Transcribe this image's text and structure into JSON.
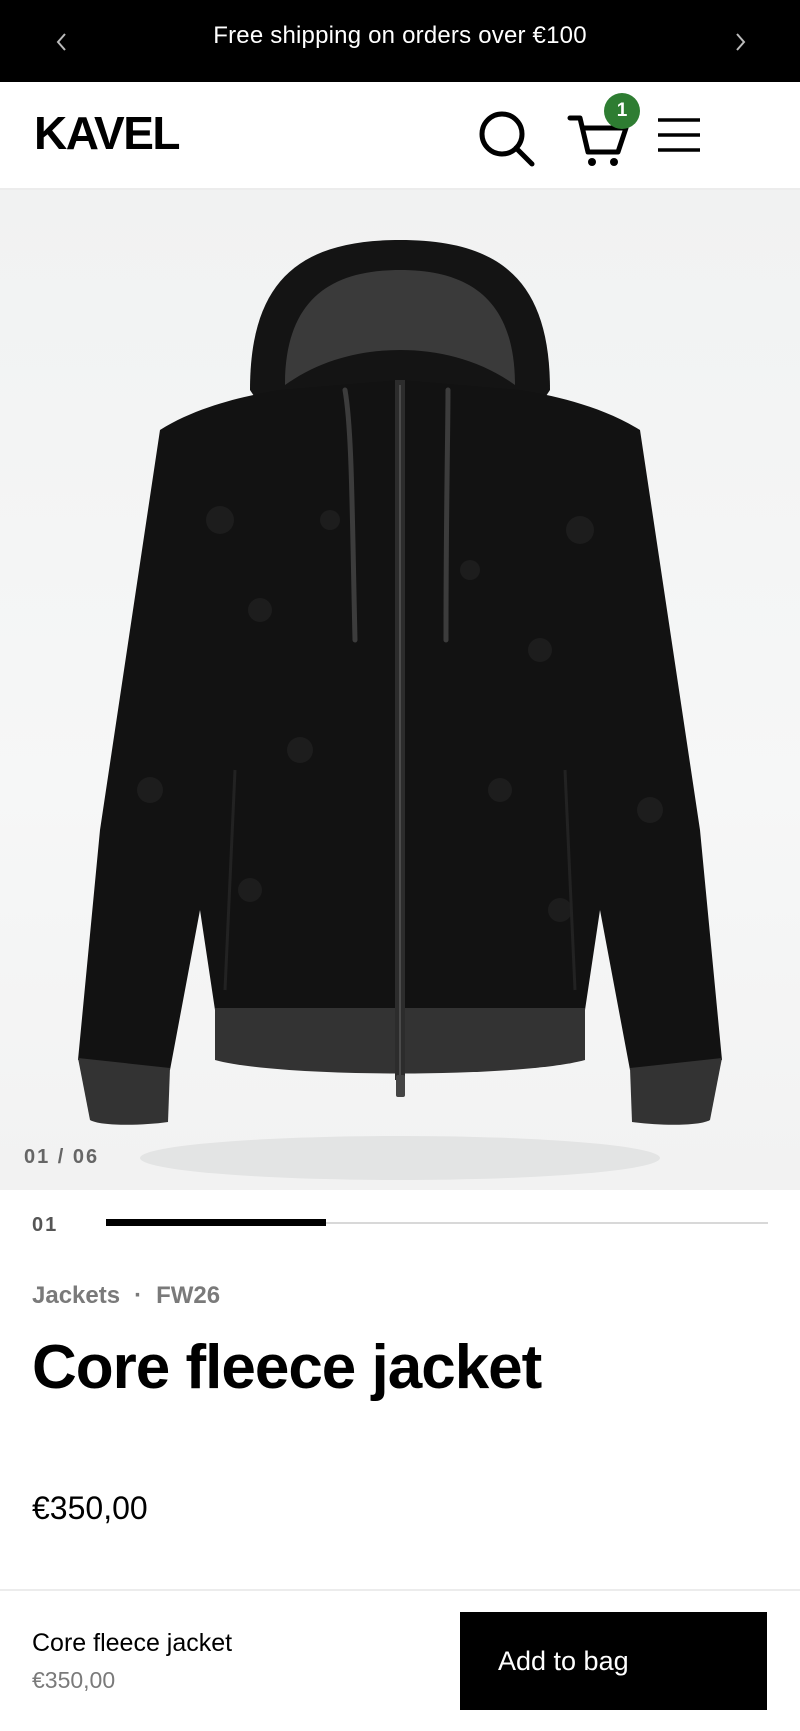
{
  "announcement": {
    "text": "Free shipping on orders over €100",
    "prev_icon": "chevron-left-icon",
    "next_icon": "chevron-right-icon"
  },
  "header": {
    "logo": "KAVEL",
    "search_icon": "search-icon",
    "cart_icon": "cart-icon",
    "cart_count": "1",
    "cart_badge_color": "#2e7d32",
    "menu_icon": "hamburger-menu-icon"
  },
  "gallery": {
    "image": "black fleece hooded zip jacket",
    "counter": "01 / 06"
  },
  "progress": {
    "index": "01",
    "fraction": 0.333
  },
  "product": {
    "category": "Jackets",
    "separator": "·",
    "season": "FW26",
    "title": "Core fleece jacket",
    "price": "€350,00"
  },
  "sticky_bar": {
    "name": "Core fleece jacket",
    "price": "€350,00",
    "add_label": "Add to bag"
  }
}
